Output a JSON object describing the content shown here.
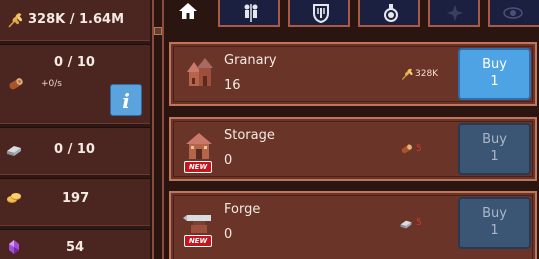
{
  "resources": {
    "wheat": {
      "icon": "wheat-icon",
      "value": "328K / 1.64M"
    },
    "wood": {
      "icon": "wood-log-icon",
      "value": "0 / 10",
      "rate": "+0/s"
    },
    "iron": {
      "icon": "iron-ingot-icon",
      "value": "0 / 10"
    },
    "gold": {
      "icon": "gold-coins-icon",
      "value": "197"
    },
    "gem": {
      "icon": "purple-gem-icon",
      "value": "54"
    }
  },
  "info_button": {
    "label": "i",
    "color": "#5aa3dd"
  },
  "tabs": [
    {
      "name": "home",
      "icon": "home-icon",
      "active": true
    },
    {
      "name": "workers",
      "icon": "workers-icon",
      "active": false
    },
    {
      "name": "defense",
      "icon": "shield-icon",
      "active": false
    },
    {
      "name": "research",
      "icon": "flask-icon",
      "active": false
    },
    {
      "name": "magic",
      "icon": "star-icon",
      "active": false
    },
    {
      "name": "vision",
      "icon": "eye-icon",
      "active": false
    }
  ],
  "buildings": [
    {
      "name": "Granary",
      "count": "16",
      "icon": "granary-icon",
      "is_new": false,
      "cost": {
        "icon": "wheat-icon",
        "value": "328K",
        "affordable": true
      },
      "buy": {
        "label": "Buy",
        "qty": "1",
        "enabled": true
      }
    },
    {
      "name": "Storage",
      "count": "0",
      "icon": "storage-icon",
      "is_new": true,
      "new_label": "NEW",
      "cost": {
        "icon": "wood-log-icon",
        "value": "5",
        "affordable": false
      },
      "buy": {
        "label": "Buy",
        "qty": "1",
        "enabled": false
      }
    },
    {
      "name": "Forge",
      "count": "0",
      "icon": "forge-icon",
      "is_new": true,
      "new_label": "NEW",
      "cost": {
        "icon": "iron-ingot-icon",
        "value": "5",
        "affordable": false
      },
      "buy": {
        "label": "Buy",
        "qty": "1",
        "enabled": false
      }
    }
  ],
  "colors": {
    "panel_bg": "#4b2620",
    "card_bg": "#6a3429",
    "card_border": "#c0765a",
    "buy_enabled": "#4ea3e4",
    "buy_disabled": "#3b5575",
    "cost_ok": "#f0e2d0",
    "cost_insufficient": "#d83a2c",
    "new_badge": "#c8141c"
  }
}
